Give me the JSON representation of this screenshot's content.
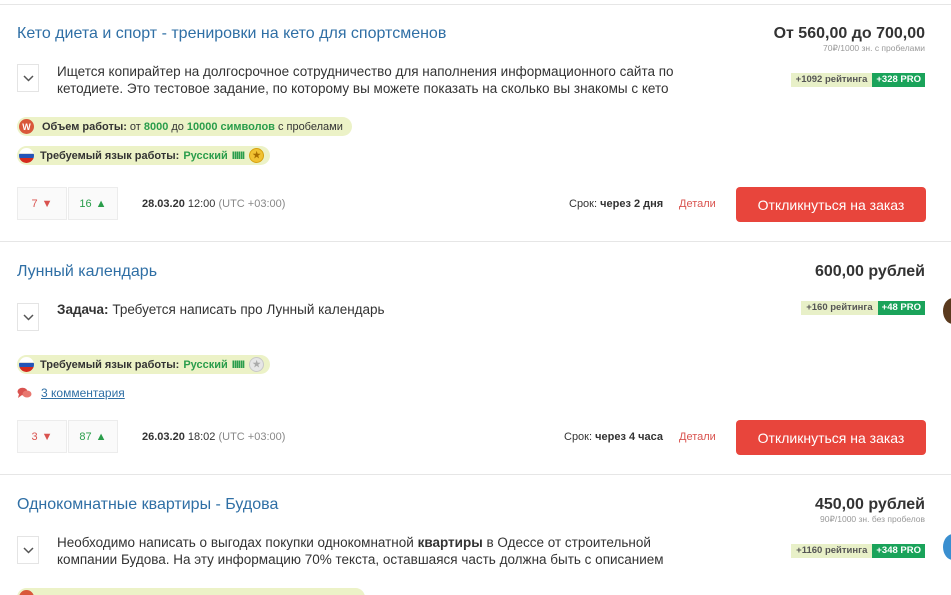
{
  "orders": [
    {
      "title": "Кето диета и спорт - тренировки на кето для спортсменов",
      "price": "От 560,00 до 700,00",
      "price_sub": "70₽/1000 зн. с пробелами",
      "description": "Ищется копирайтер на долгосрочное сотрудничество для наполнения информационного сайта по кетодиете. Это тестовое задание, по которому вы можете показать на сколько вы знакомы с кето",
      "rating": "+1092 рейтинга",
      "pro": "+328 PRO",
      "volume": {
        "badge": "W",
        "label": "Объем работы:",
        "from": "от",
        "min": "8000",
        "to": "до",
        "max": "10000 символов",
        "suffix": "с пробелами"
      },
      "language": {
        "label": "Требуемый язык работы:",
        "value": "Русский",
        "level": "IIIIII"
      },
      "votes_down": "7",
      "votes_up": "16",
      "date": "28.03.20",
      "time": "12:00",
      "tz": "(UTC +03:00)",
      "deadline_label": "Срок:",
      "deadline_value": "через 2 дня",
      "details": "Детали",
      "respond": "Откликнуться на заказ"
    },
    {
      "title": "Лунный календарь",
      "price": "600,00 рублей",
      "description_bold": "Задача:",
      "description": "Требуется написать про Лунный календарь",
      "rating": "+160 рейтинга",
      "pro": "+48 PRO",
      "language": {
        "label": "Требуемый язык работы:",
        "value": "Русский",
        "level": "IIIIII"
      },
      "comments": "3 комментария",
      "votes_down": "3",
      "votes_up": "87",
      "date": "26.03.20",
      "time": "18:02",
      "tz": "(UTC +03:00)",
      "deadline_label": "Срок:",
      "deadline_value": "через 4 часа",
      "details": "Детали",
      "respond": "Откликнуться на заказ"
    },
    {
      "title": "Однокомнатные квартиры - Будова",
      "price": "450,00 рублей",
      "price_sub": "90₽/1000 зн. без пробелов",
      "description_a": "Необходимо написать о выгодах покупки однокомнатной",
      "description_bold": "квартиры",
      "description_b": "в Одессе от строительной компании Будова. На эту информацию 70% текста, оставшаяся часть должна быть с описанием",
      "rating": "+1160 рейтинга",
      "pro": "+348 PRO"
    }
  ],
  "colors": {
    "accent_blue": "#2f6fa5",
    "respond_red": "#e8453c",
    "pro_green": "#1aa35a",
    "chip_bg": "#ecf2c7"
  }
}
